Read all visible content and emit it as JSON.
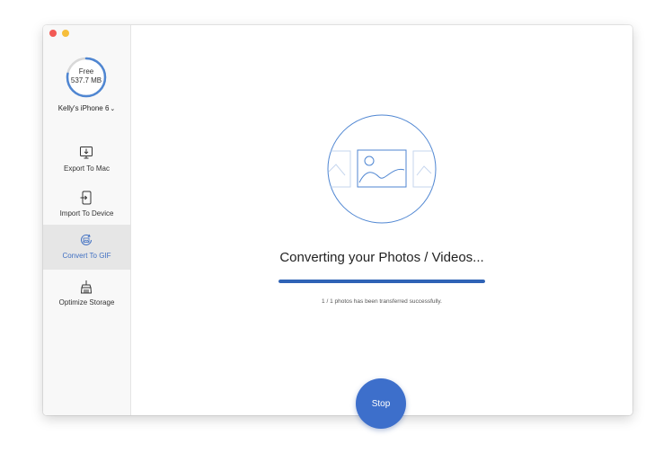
{
  "sidebar": {
    "storage": {
      "label": "Free",
      "value": "537.7 MB",
      "used_fraction": 0.22
    },
    "device_name": "Kelly's iPhone 6",
    "device_chevron": "⌄",
    "items": [
      {
        "label": "Export To Mac",
        "icon": "export-to-mac-icon"
      },
      {
        "label": "Import To Device",
        "icon": "import-to-device-icon"
      },
      {
        "label": "Convert To GIF",
        "icon": "convert-to-gif-icon",
        "active": true
      },
      {
        "label": "Optimize Storage",
        "icon": "optimize-storage-icon"
      }
    ]
  },
  "main": {
    "status_title": "Converting your Photos / Videos...",
    "progress_fraction": 1.0,
    "status_sub": "1 / 1 photos has been transferred successfully.",
    "stop_label": "Stop"
  },
  "colors": {
    "accent": "#3d6fcb",
    "ring": "#4f86d2",
    "close": "#f25a55",
    "minimize": "#f6be3b"
  }
}
